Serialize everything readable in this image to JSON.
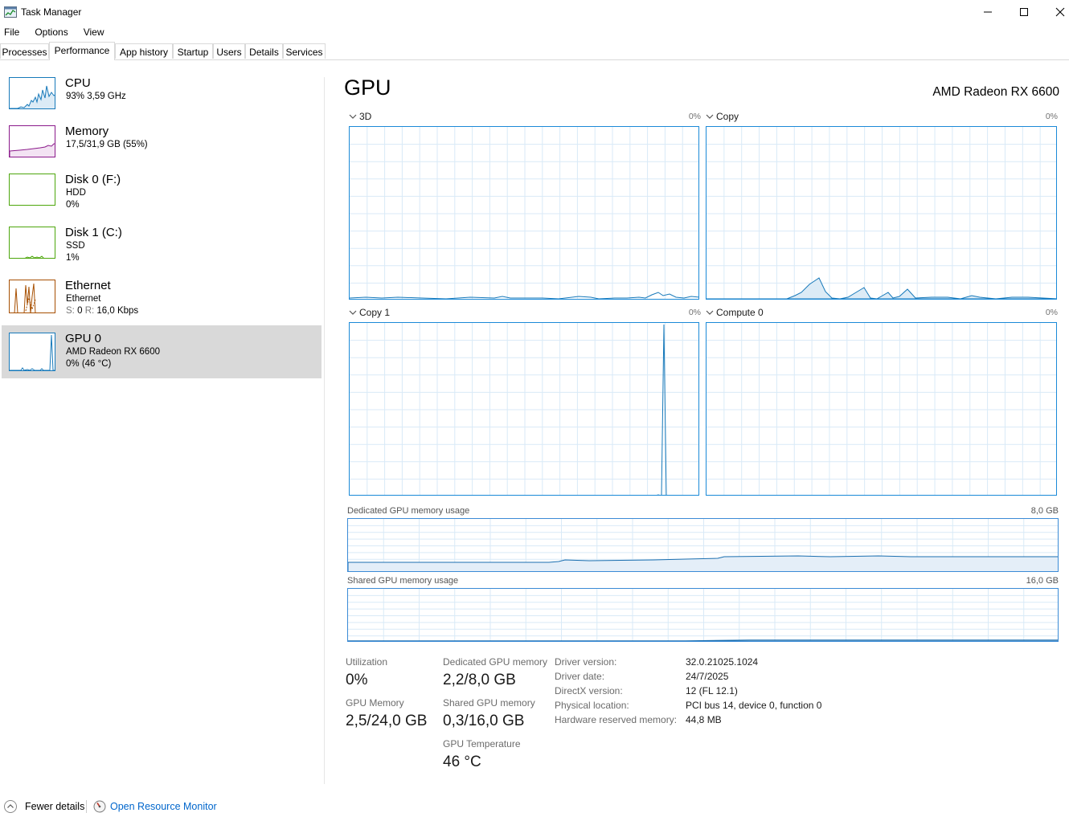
{
  "window": {
    "title": "Task Manager"
  },
  "menu": [
    "File",
    "Options",
    "View"
  ],
  "tabs": [
    {
      "label": "Processes"
    },
    {
      "label": "Performance"
    },
    {
      "label": "App history"
    },
    {
      "label": "Startup"
    },
    {
      "label": "Users"
    },
    {
      "label": "Details"
    },
    {
      "label": "Services"
    }
  ],
  "sidebar": {
    "items": [
      {
        "name": "CPU",
        "line1": "93%  3,59 GHz",
        "color": "#1779ba"
      },
      {
        "name": "Memory",
        "line1": "17,5/31,9 GB (55%)",
        "color": "#8b1a8b"
      },
      {
        "name": "Disk 0 (F:)",
        "line1": "HDD",
        "line2": "0%",
        "color": "#4da60c"
      },
      {
        "name": "Disk 1 (C:)",
        "line1": "SSD",
        "line2": "1%",
        "color": "#4da60c"
      },
      {
        "name": "Ethernet",
        "line1": "Ethernet",
        "s_label": "S:",
        "s_value": "0",
        "r_label": "R:",
        "r_value": "16,0 Kbps",
        "color": "#a74f01"
      },
      {
        "name": "GPU 0",
        "line1": "AMD Radeon RX 6600",
        "line2": "0%  (46 °C)",
        "color": "#1779ba"
      }
    ]
  },
  "main": {
    "title": "GPU",
    "model": "AMD Radeon RX 6600",
    "engines": [
      {
        "label": "3D",
        "percent": "0%"
      },
      {
        "label": "Copy",
        "percent": "0%"
      },
      {
        "label": "Copy 1",
        "percent": "0%"
      },
      {
        "label": "Compute 0",
        "percent": "0%"
      }
    ],
    "dedicated": {
      "label": "Dedicated GPU memory usage",
      "max": "8,0 GB"
    },
    "shared": {
      "label": "Shared GPU memory usage",
      "max": "16,0 GB"
    },
    "stats": {
      "utilization_label": "Utilization",
      "utilization_value": "0%",
      "gpu_memory_label": "GPU Memory",
      "gpu_memory_value": "2,5/24,0 GB",
      "dedicated_label": "Dedicated GPU memory",
      "dedicated_value": "2,2/8,0 GB",
      "shared_label": "Shared GPU memory",
      "shared_value": "0,3/16,0 GB",
      "temp_label": "GPU Temperature",
      "temp_value": "46 °C"
    },
    "info": [
      {
        "key": "Driver version:",
        "value": "32.0.21025.1024"
      },
      {
        "key": "Driver date:",
        "value": "24/7/2025"
      },
      {
        "key": "DirectX version:",
        "value": "12 (FL 12.1)"
      },
      {
        "key": "Physical location:",
        "value": "PCI bus 14, device 0, function 0"
      },
      {
        "key": "Hardware reserved memory:",
        "value": "44,8 MB"
      }
    ]
  },
  "footer": {
    "fewer_details": "Fewer details",
    "resource_monitor": "Open Resource Monitor"
  }
}
